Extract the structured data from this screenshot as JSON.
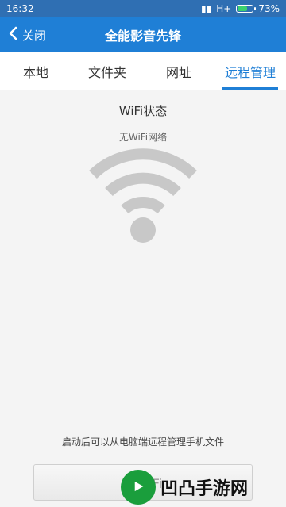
{
  "statusbar": {
    "time": "16:32",
    "network": "H+",
    "battery_percent": "73%",
    "battery_level": 0.73
  },
  "header": {
    "back_label": "关闭",
    "title": "全能影音先锋"
  },
  "tabs": [
    {
      "label": "本地"
    },
    {
      "label": "文件夹"
    },
    {
      "label": "网址"
    },
    {
      "label": "远程管理"
    }
  ],
  "content": {
    "wifi_title": "WiFi状态",
    "wifi_state": "无WiFi网络",
    "hint": "启动后可以从电脑端远程管理手机文件",
    "button_label": "无WiFi"
  },
  "watermark": {
    "text": "凹凸手游网"
  },
  "colors": {
    "accent": "#1f7fd6",
    "wifi_gray": "#c8c8c8"
  }
}
